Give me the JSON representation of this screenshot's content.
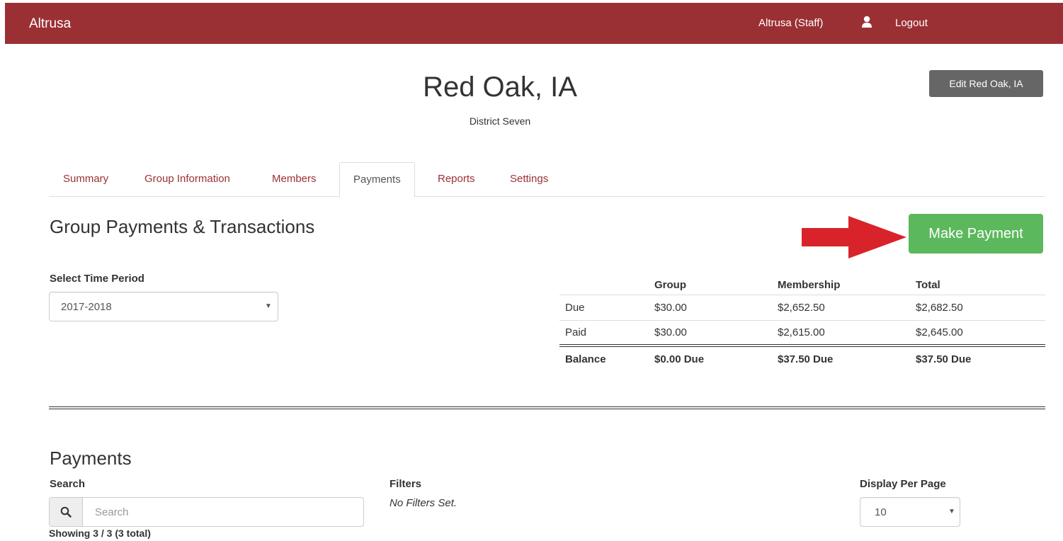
{
  "navbar": {
    "brand": "Altrusa",
    "user": "Altrusa (Staff)",
    "user_icon": "user-icon",
    "logout": "Logout",
    "bg_color": "#9b3034"
  },
  "header": {
    "title": "Red Oak, IA",
    "subtitle": "District Seven",
    "edit_button": "Edit Red Oak, IA"
  },
  "tabs": [
    {
      "label": "Summary",
      "active": false
    },
    {
      "label": "Group Information",
      "active": false
    },
    {
      "label": "Members",
      "active": false
    },
    {
      "label": "Payments",
      "active": true
    },
    {
      "label": "Reports",
      "active": false
    },
    {
      "label": "Settings",
      "active": false
    }
  ],
  "transactions": {
    "title": "Group Payments & Transactions",
    "make_payment": "Make Payment",
    "make_payment_color": "#5cb85c",
    "annotation_arrow_color": "#d9232a",
    "time_period_label": "Select Time Period",
    "time_period_value": "2017-2018",
    "summary": {
      "headers": [
        "",
        "Group",
        "Membership",
        "Total"
      ],
      "rows": [
        [
          "Due",
          "$30.00",
          "$2,652.50",
          "$2,682.50"
        ],
        [
          "Paid",
          "$30.00",
          "$2,615.00",
          "$2,645.00"
        ]
      ],
      "balance": [
        "Balance",
        "$0.00 Due",
        "$37.50 Due",
        "$37.50 Due"
      ]
    }
  },
  "payments": {
    "title": "Payments",
    "search_label": "Search",
    "search_placeholder": "Search",
    "search_icon": "search-icon",
    "filters_label": "Filters",
    "filters_value": "No Filters Set.",
    "per_page_label": "Display Per Page",
    "per_page_value": "10",
    "showing": "Showing 3 / 3 (3 total)"
  }
}
